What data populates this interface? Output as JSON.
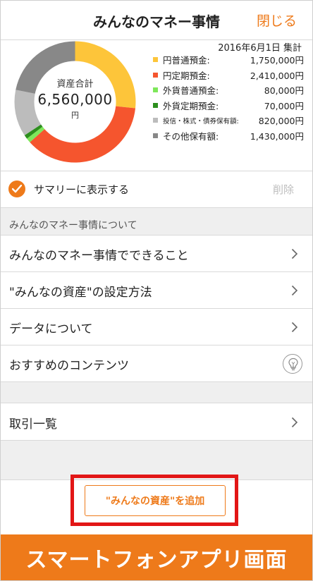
{
  "header": {
    "title": "みんなのマネー事情",
    "close_label": "閉じる"
  },
  "summary": {
    "date_label": "2016年6月1日 集計",
    "total_label": "資産合計",
    "total_value": "6,560,000",
    "total_unit": "円",
    "legend": [
      {
        "label": "円普通預金:",
        "value": "1,750,000円",
        "color": "#fdc53a",
        "amount": 1750000
      },
      {
        "label": "円定期預金:",
        "value": "2,410,000円",
        "color": "#f5552e",
        "amount": 2410000
      },
      {
        "label": "外貨普通預金:",
        "value": "80,000円",
        "color": "#7ee75a",
        "amount": 80000
      },
      {
        "label": "外貨定期預金:",
        "value": "70,000円",
        "color": "#2d8f1e",
        "amount": 70000
      },
      {
        "label": "投信・株式・債券保有額:",
        "value": "820,000円",
        "color": "#bcbcbc",
        "amount": 820000
      },
      {
        "label": "その他保有額:",
        "value": "1,430,000円",
        "color": "#888888",
        "amount": 1430000
      }
    ]
  },
  "toggle": {
    "label": "サマリーに表示する",
    "checked": true,
    "delete_label": "削除"
  },
  "section": {
    "title": "みんなのマネー事情について"
  },
  "list": {
    "items": [
      {
        "label": "みんなのマネー事情でできること",
        "icon": "chevron-right-icon"
      },
      {
        "label": "\"みんなの資産\"の設定方法",
        "icon": "chevron-right-icon"
      },
      {
        "label": "データについて",
        "icon": "chevron-right-icon"
      },
      {
        "label": "おすすめのコンテンツ",
        "icon": "lightbulb-icon"
      }
    ],
    "transactions_label": "取引一覧"
  },
  "actions": {
    "add_label": "\"みんなの資産\"を追加",
    "highlight_color": "#e21616"
  },
  "footer": {
    "banner_text": "スマートフォンアプリ画面",
    "color": "#ee7a1a"
  }
}
